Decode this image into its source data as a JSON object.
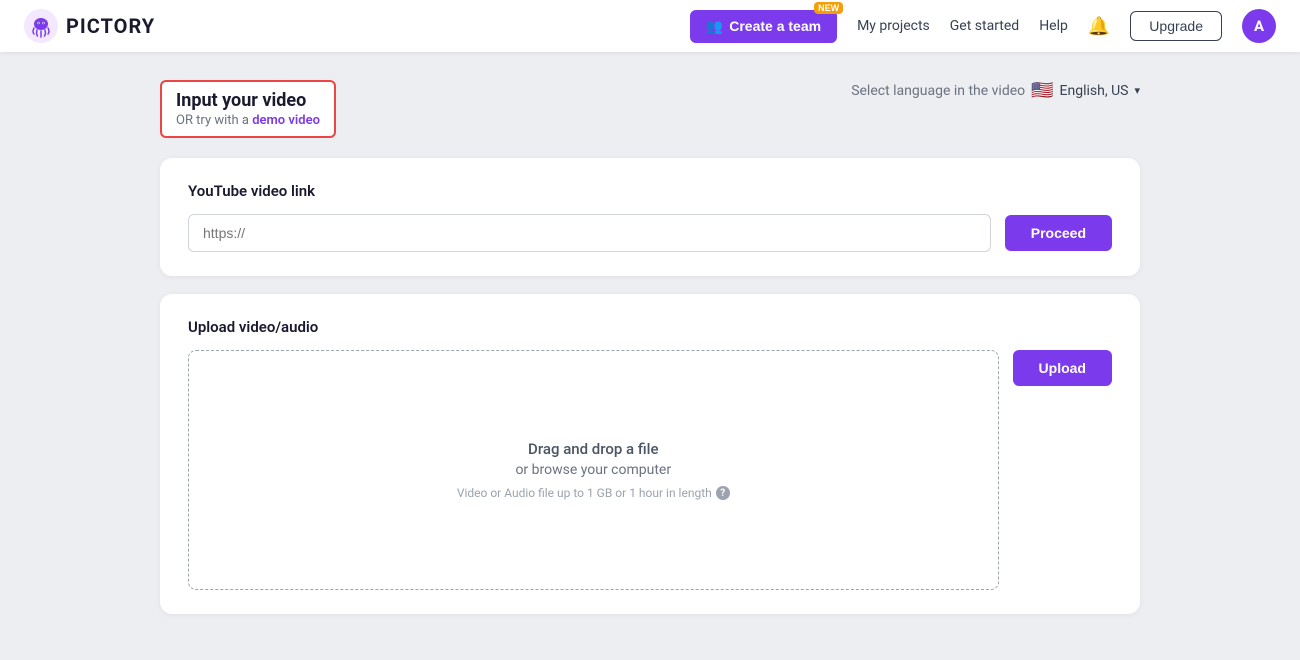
{
  "brand": {
    "name": "PICTORY",
    "logo_alt": "Pictory logo"
  },
  "navbar": {
    "create_team_label": "Create a team",
    "badge_new": "NEW",
    "my_projects": "My projects",
    "get_started": "Get started",
    "help": "Help",
    "upgrade_label": "Upgrade",
    "avatar_initial": "A"
  },
  "header": {
    "title": "Input your video",
    "subtitle_prefix": "OR try with a",
    "demo_link_text": "demo video",
    "lang_label": "Select language in the video",
    "lang_value": "English, US",
    "flag_emoji": "🇺🇸"
  },
  "youtube_section": {
    "title": "YouTube video link",
    "input_placeholder": "https://",
    "proceed_label": "Proceed"
  },
  "upload_section": {
    "title": "Upload video/audio",
    "dropzone_line1": "Drag and drop a file",
    "dropzone_line2": "or browse your computer",
    "dropzone_hint": "Video or Audio file up to 1 GB or 1 hour in length",
    "upload_label": "Upload"
  },
  "icons": {
    "team_icon": "👥",
    "bell_icon": "🔔",
    "chevron_down": "▾"
  }
}
